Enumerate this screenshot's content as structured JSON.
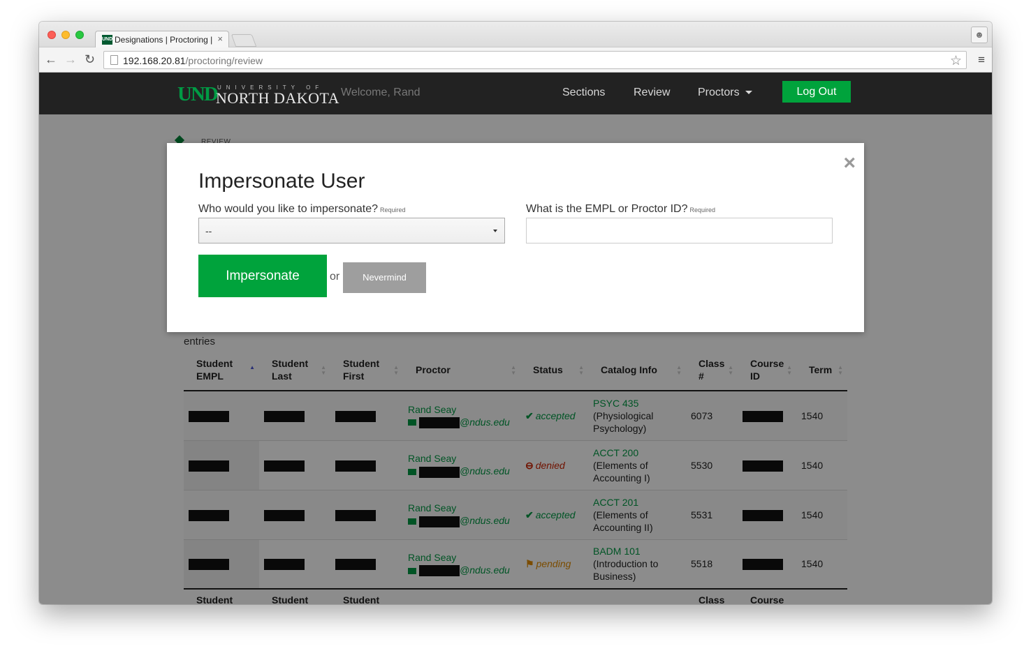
{
  "browser": {
    "tab_title": "Designations | Proctoring |",
    "tab_favicon": "UND",
    "tab_close": "×",
    "url_host": "192.168.20.81",
    "url_path": "/proctoring/review"
  },
  "navbar": {
    "logo_und": "UND",
    "logo_university_of": "UNIVERSITY OF",
    "logo_north_dakota": "NORTH DAKOTA",
    "welcome": "Welcome, Rand",
    "links": [
      "Sections",
      "Review",
      "Proctors"
    ],
    "logout": "Log Out"
  },
  "breadcrumb": "REVIEW",
  "entries_label": "entries",
  "table": {
    "headers": [
      {
        "label": "Student EMPL"
      },
      {
        "label": "Student Last"
      },
      {
        "label": "Student First"
      },
      {
        "label": "Proctor"
      },
      {
        "label": "Status"
      },
      {
        "label": "Catalog Info"
      },
      {
        "label": "Class #"
      },
      {
        "label": "Course ID"
      },
      {
        "label": "Term"
      }
    ],
    "rows": [
      {
        "proctor_name": "Rand Seay",
        "proctor_email_suffix": "@ndus.edu",
        "status": "accepted",
        "catalog_code": "PSYC 435",
        "catalog_desc": "(Physiological Psychology)",
        "class_num": "6073",
        "term": "1540"
      },
      {
        "proctor_name": "Rand Seay",
        "proctor_email_suffix": "@ndus.edu",
        "status": "denied",
        "catalog_code": "ACCT 200",
        "catalog_desc": "(Elements of Accounting I)",
        "class_num": "5530",
        "term": "1540"
      },
      {
        "proctor_name": "Rand Seay",
        "proctor_email_suffix": "@ndus.edu",
        "status": "accepted",
        "catalog_code": "ACCT 201",
        "catalog_desc": "(Elements of Accounting II)",
        "class_num": "5531",
        "term": "1540"
      },
      {
        "proctor_name": "Rand Seay",
        "proctor_email_suffix": "@ndus.edu",
        "status": "pending",
        "catalog_code": "BADM 101",
        "catalog_desc": "(Introduction to Business)",
        "class_num": "5518",
        "term": "1540"
      }
    ],
    "footer_headers": [
      "Student",
      "Student",
      "Student",
      "",
      "",
      "",
      "Class",
      "Course",
      ""
    ]
  },
  "modal": {
    "title": "Impersonate User",
    "who_label": "Who would you like to impersonate?",
    "who_required": "Required",
    "who_value": "--",
    "id_label": "What is the EMPL or Proctor ID?",
    "id_required": "Required",
    "id_value": "",
    "submit": "Impersonate",
    "or": "or",
    "cancel": "Nevermind",
    "close": "×"
  },
  "colors": {
    "brand_green": "#00a33c",
    "navbar_bg": "#222222",
    "denied": "#cc2200",
    "pending": "#e08a00"
  },
  "icons": {
    "status_accepted": "✔",
    "status_denied": "⊖",
    "status_pending": "⚑"
  }
}
